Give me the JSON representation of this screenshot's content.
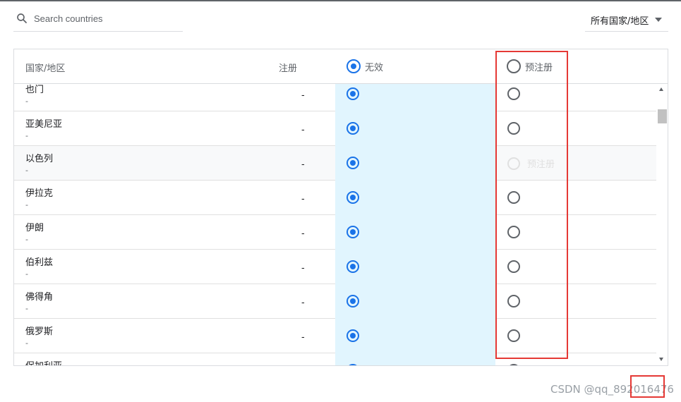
{
  "search": {
    "placeholder": "Search countries"
  },
  "region_filter": {
    "selected": "所有国家/地区"
  },
  "table": {
    "headers": {
      "country": "国家/地区",
      "registration": "注册",
      "none": "无效",
      "pre": "预注册"
    },
    "rows": [
      {
        "name": "也门",
        "sub": "-",
        "registration": "-",
        "selected": "none",
        "pre_hover_label": ""
      },
      {
        "name": "亚美尼亚",
        "sub": "-",
        "registration": "-",
        "selected": "none",
        "pre_hover_label": ""
      },
      {
        "name": "以色列",
        "sub": "-",
        "registration": "-",
        "selected": "none",
        "pre_hover_label": "预注册"
      },
      {
        "name": "伊拉克",
        "sub": "-",
        "registration": "-",
        "selected": "none",
        "pre_hover_label": ""
      },
      {
        "name": "伊朗",
        "sub": "-",
        "registration": "-",
        "selected": "none",
        "pre_hover_label": ""
      },
      {
        "name": "伯利兹",
        "sub": "-",
        "registration": "-",
        "selected": "none",
        "pre_hover_label": ""
      },
      {
        "name": "佛得角",
        "sub": "-",
        "registration": "-",
        "selected": "none",
        "pre_hover_label": ""
      },
      {
        "name": "俄罗斯",
        "sub": "-",
        "registration": "-",
        "selected": "none",
        "pre_hover_label": ""
      },
      {
        "name": "保加利亚",
        "sub": "",
        "registration": "",
        "selected": "none",
        "pre_hover_label": ""
      }
    ]
  },
  "watermark": "CSDN @qq_892016476",
  "colors": {
    "accent": "#1a73e8",
    "selected_column_bg": "#e1f5fe",
    "annotation_red": "#e53935"
  }
}
